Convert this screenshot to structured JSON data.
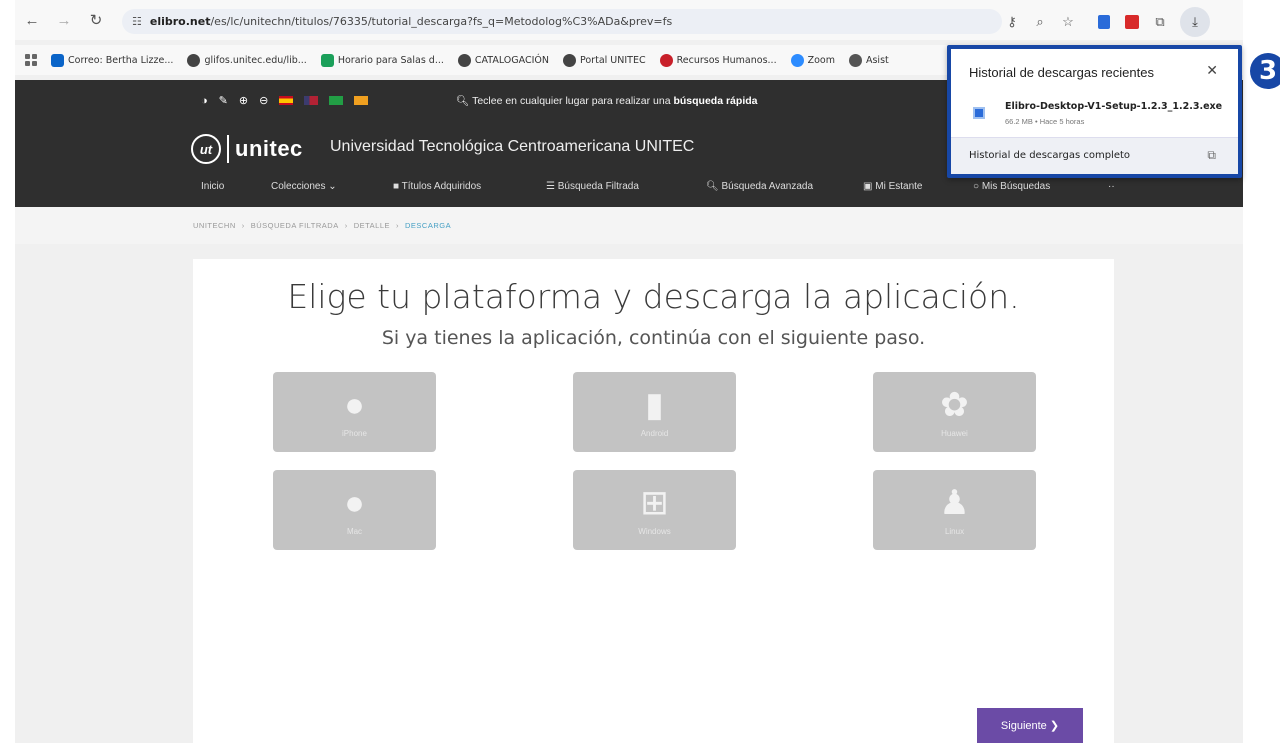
{
  "browser": {
    "url_host": "elibro.net",
    "url_path": "/es/lc/unitechn/titulos/76335/tutorial_descarga?fs_q=Metodolog%C3%ADa&prev=fs",
    "bookmarks": [
      {
        "label": "Correo: Bertha Lizze...",
        "color": "#0a64c8"
      },
      {
        "label": "glifos.unitec.edu/lib...",
        "color": "#444444"
      },
      {
        "label": "Horario para Salas d...",
        "color": "#1ba05a"
      },
      {
        "label": "CATALOGACIÓN",
        "color": "#444444"
      },
      {
        "label": "Portal UNITEC",
        "color": "#444444"
      },
      {
        "label": "Recursos Humanos...",
        "color": "#c8202a"
      },
      {
        "label": "Zoom",
        "color": "#2d8cff"
      },
      {
        "label": "Asist",
        "color": "#555555"
      }
    ]
  },
  "header": {
    "quick_search_prefix": "Teclee en cualquier lugar para realizar una",
    "quick_search_bold": "búsqueda rápida",
    "logo_mark": "ut",
    "logo_text": "unitec",
    "university": "Universidad Tecnológica Centroamericana UNITEC",
    "menu": [
      "Inicio",
      "Colecciones",
      "Títulos Adquiridos",
      "Búsqueda Filtrada",
      "Búsqueda Avanzada",
      "Mi Estante",
      "Mis Búsquedas",
      "··"
    ]
  },
  "breadcrumb": [
    "UNITECHN",
    "BÚSQUEDA FILTRADA",
    "DETALLE",
    "DESCARGA"
  ],
  "main": {
    "title": "Elige tu plataforma y descarga la aplicación.",
    "subtitle": "Si ya tienes la aplicación, continúa con el siguiente paso.",
    "platforms": [
      {
        "label": "iPhone",
        "icon": "apple-icon"
      },
      {
        "label": "Android",
        "icon": "android-icon"
      },
      {
        "label": "Huawei",
        "icon": "huawei-icon"
      },
      {
        "label": "Mac",
        "icon": "apple-icon"
      },
      {
        "label": "Windows",
        "icon": "windows-icon"
      },
      {
        "label": "Linux",
        "icon": "linux-icon"
      }
    ],
    "next_label": "Siguiente"
  },
  "downloads": {
    "title": "Historial de descargas recientes",
    "file_name": "Elibro-Desktop-V1-Setup-1.2.3_1.2.3.exe",
    "file_meta": "66.2 MB • Hace 5 horas",
    "footer": "Historial de descargas completo"
  },
  "annotation_badge": "3"
}
